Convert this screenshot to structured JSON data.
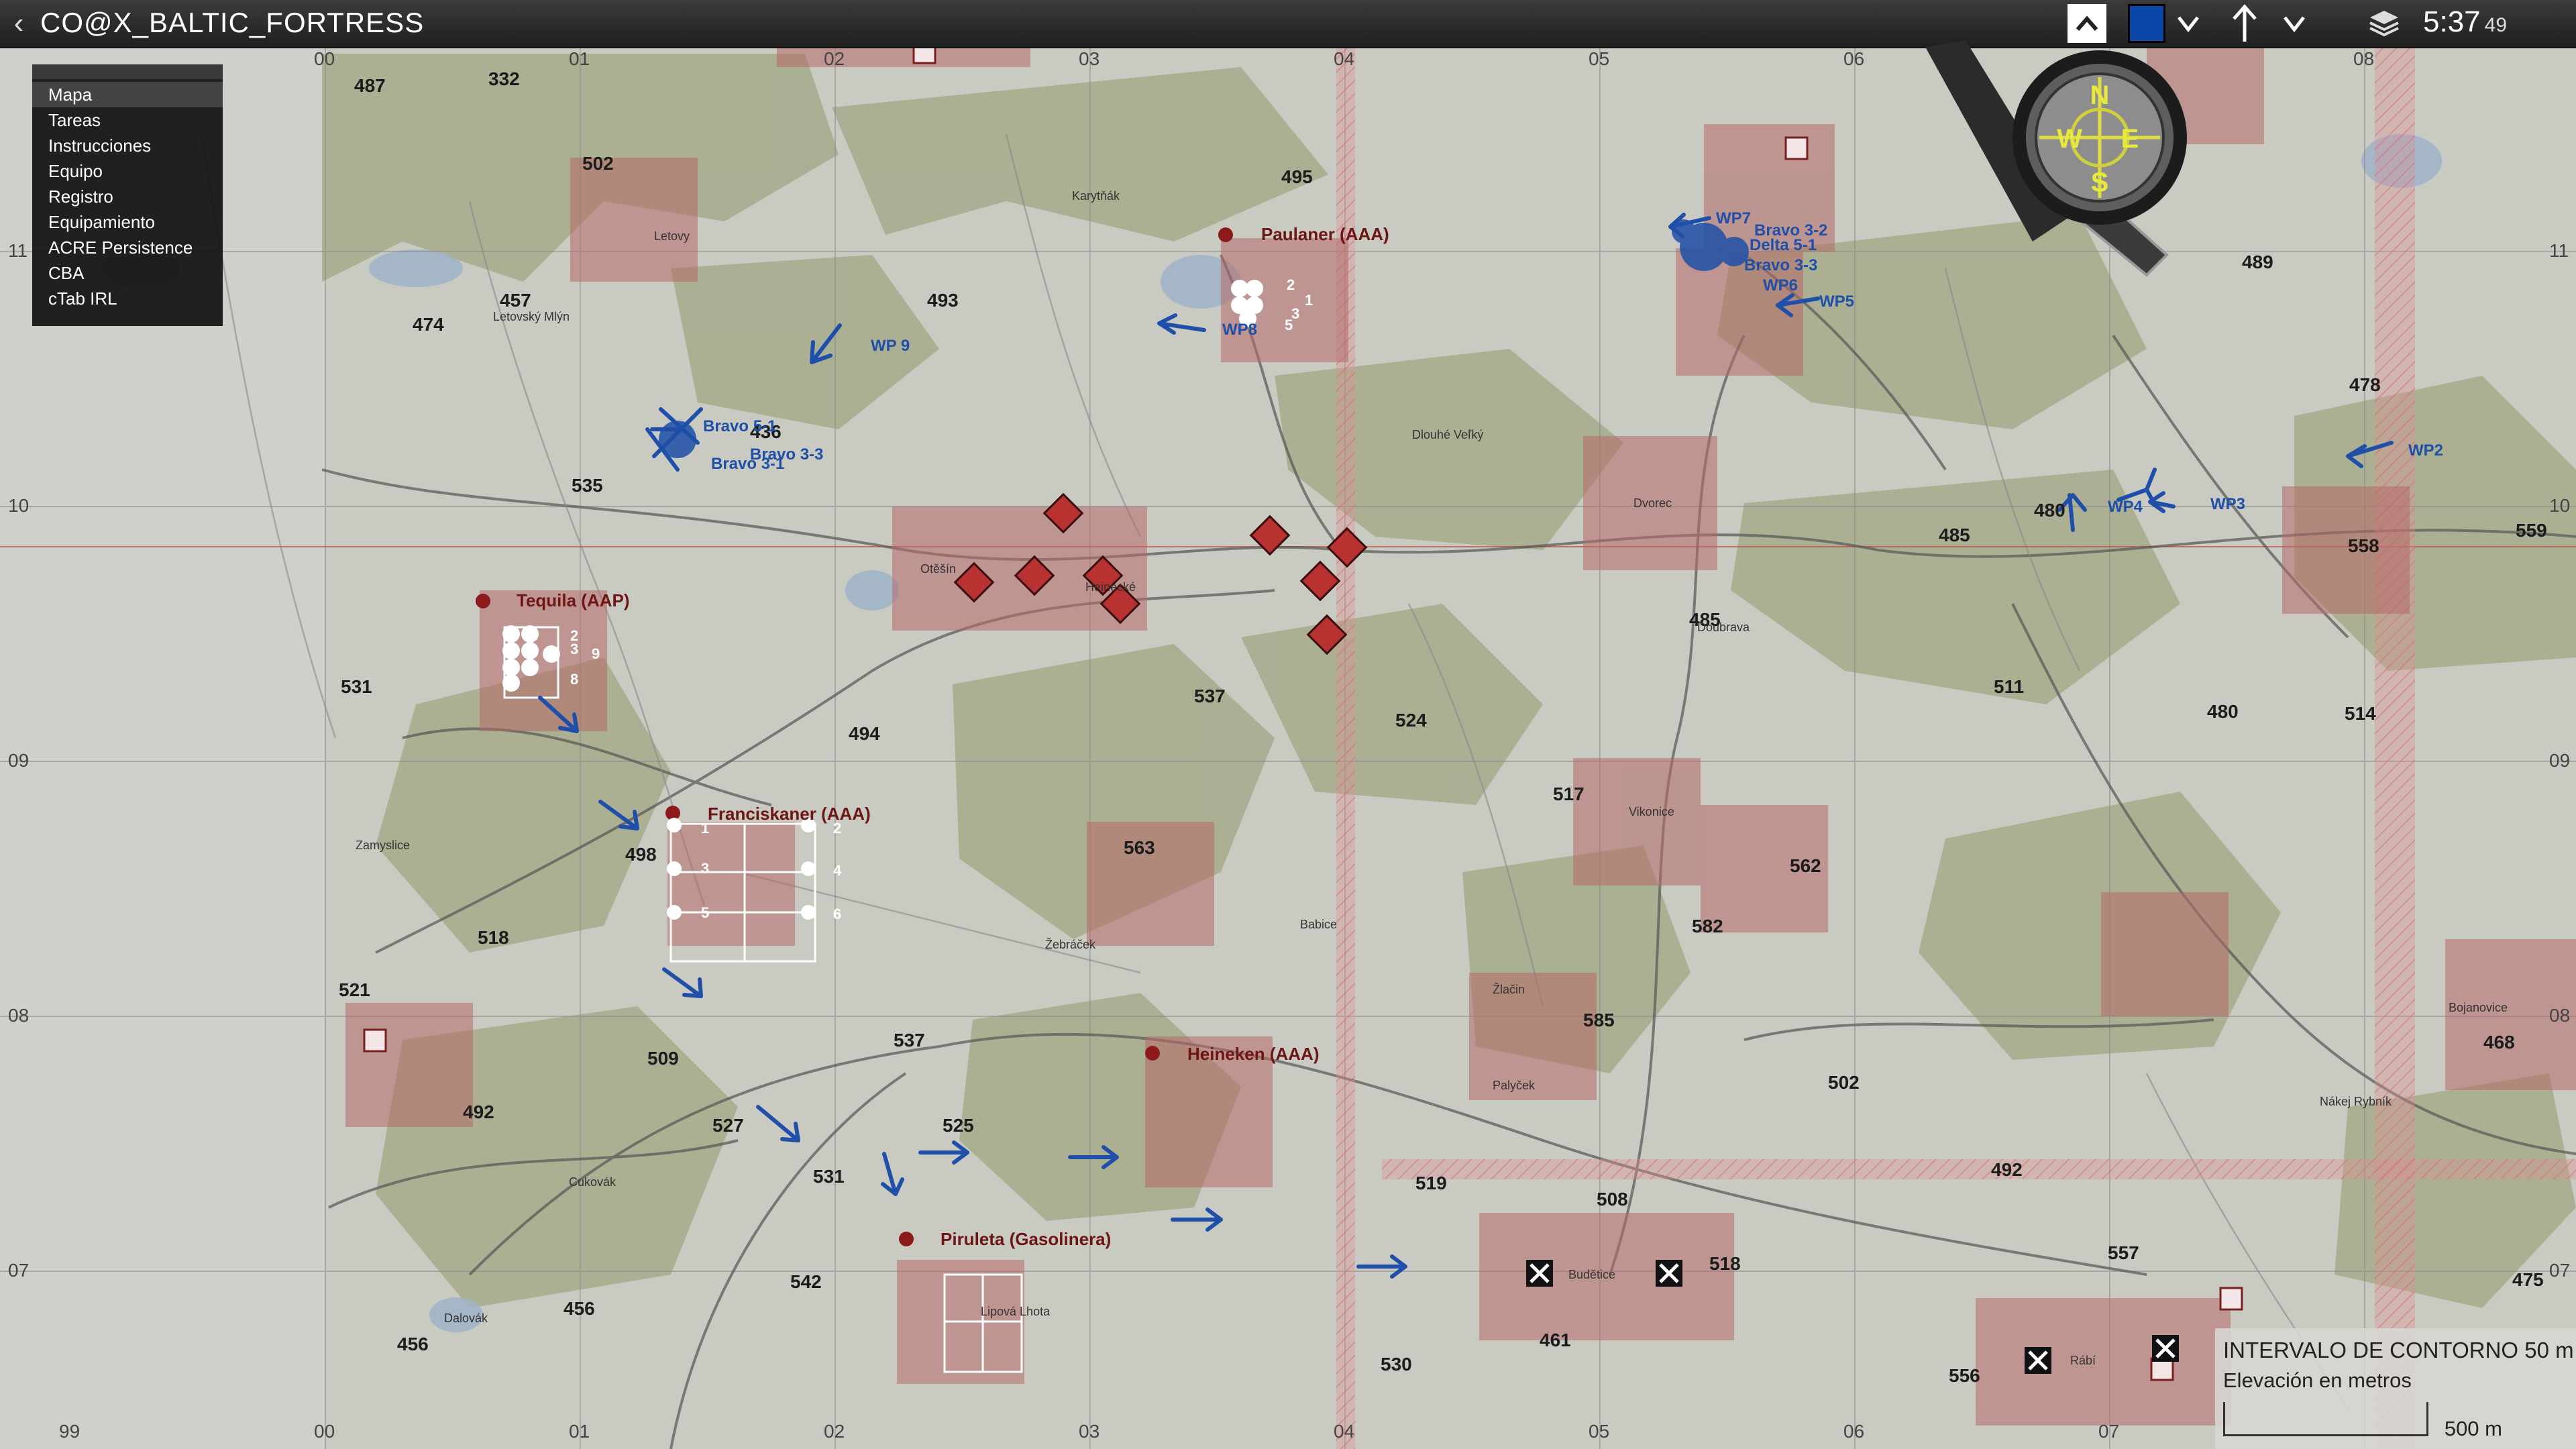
{
  "window": {
    "title": "CO@X_BALTIC_FORTRESS",
    "clock": "5:37",
    "clock_seconds": "49"
  },
  "menu": {
    "items": [
      "Mapa",
      "Tareas",
      "Instrucciones",
      "Equipo",
      "Registro",
      "Equipamiento",
      "ACRE Persistence",
      "CBA",
      "cTab IRL"
    ],
    "selected": "Mapa"
  },
  "colors": {
    "map_bg": "#c9cbc2",
    "forest": "#a8ad8e",
    "marker_red": "#8c1a1a",
    "waypoint_blue": "#1f4fa8",
    "hatch_red": "#d8818a",
    "water": "#9fb3c8"
  },
  "map": {
    "grid_top_labels": [
      "00",
      "01",
      "02",
      "03",
      "04",
      "05",
      "06",
      "07",
      "08"
    ],
    "grid_bottom_labels": [
      "99",
      "00",
      "01",
      "02",
      "03",
      "04",
      "05",
      "06",
      "07"
    ],
    "grid_side_labels": [
      "11",
      "10",
      "09",
      "08",
      "07"
    ],
    "elevations": [
      "487",
      "332",
      "502",
      "495",
      "493",
      "457",
      "474",
      "535",
      "436",
      "531",
      "494",
      "537",
      "524",
      "485",
      "485",
      "480",
      "478",
      "489",
      "559",
      "558",
      "511",
      "480",
      "514",
      "517",
      "562",
      "582",
      "585",
      "563",
      "521",
      "498",
      "518",
      "509",
      "527",
      "531",
      "525",
      "537",
      "542",
      "456",
      "456",
      "492",
      "492",
      "461",
      "518",
      "519",
      "508",
      "530",
      "502",
      "557",
      "556",
      "468",
      "475"
    ],
    "markers": [
      {
        "label": "Paulaner (AAA)"
      },
      {
        "label": "Tequila (AAP)"
      },
      {
        "label": "Franciskaner (AAA)"
      },
      {
        "label": "Heineken (AAA)"
      },
      {
        "label": "Piruleta (Gasolinera)"
      }
    ],
    "waypoints": [
      "WP 9",
      "WP8",
      "WP7",
      "WP6",
      "WP5",
      "WP4",
      "WP3",
      "WP2"
    ],
    "units": [
      "Bravo 5-1",
      "Bravo 3-3",
      "Bravo 3-1",
      "Bravo 3-2",
      "Delta 5-1",
      "Bravo 3-3"
    ],
    "towns": [
      "Letovy",
      "Letovský Mlýn",
      "Otěšín",
      "Dlouhé Veľký",
      "Dvorec",
      "Doubrava",
      "Vikonice",
      "Budětice",
      "Lipová Lhota",
      "Cukovák",
      "Dalovák",
      "Zamyslice",
      "Žebráček",
      "Babice",
      "Heinecké",
      "Rábí",
      "Bojanovice",
      "Nákej Rybník",
      "Karytňák",
      "Žlačin",
      "Palyček"
    ],
    "tequila_slots": [
      "1",
      "2",
      "3",
      "4",
      "5",
      "6",
      "7",
      "8",
      "9"
    ],
    "franciskaner_slots": [
      "1",
      "2",
      "3",
      "4",
      "5",
      "6"
    ],
    "paulaner_slots": [
      "2",
      "1",
      "3",
      "5",
      "4"
    ]
  },
  "legend": {
    "title": "INTERVALO DE CONTORNO 50 m",
    "subtitle": "Elevación en metros",
    "scale": "500 m"
  }
}
